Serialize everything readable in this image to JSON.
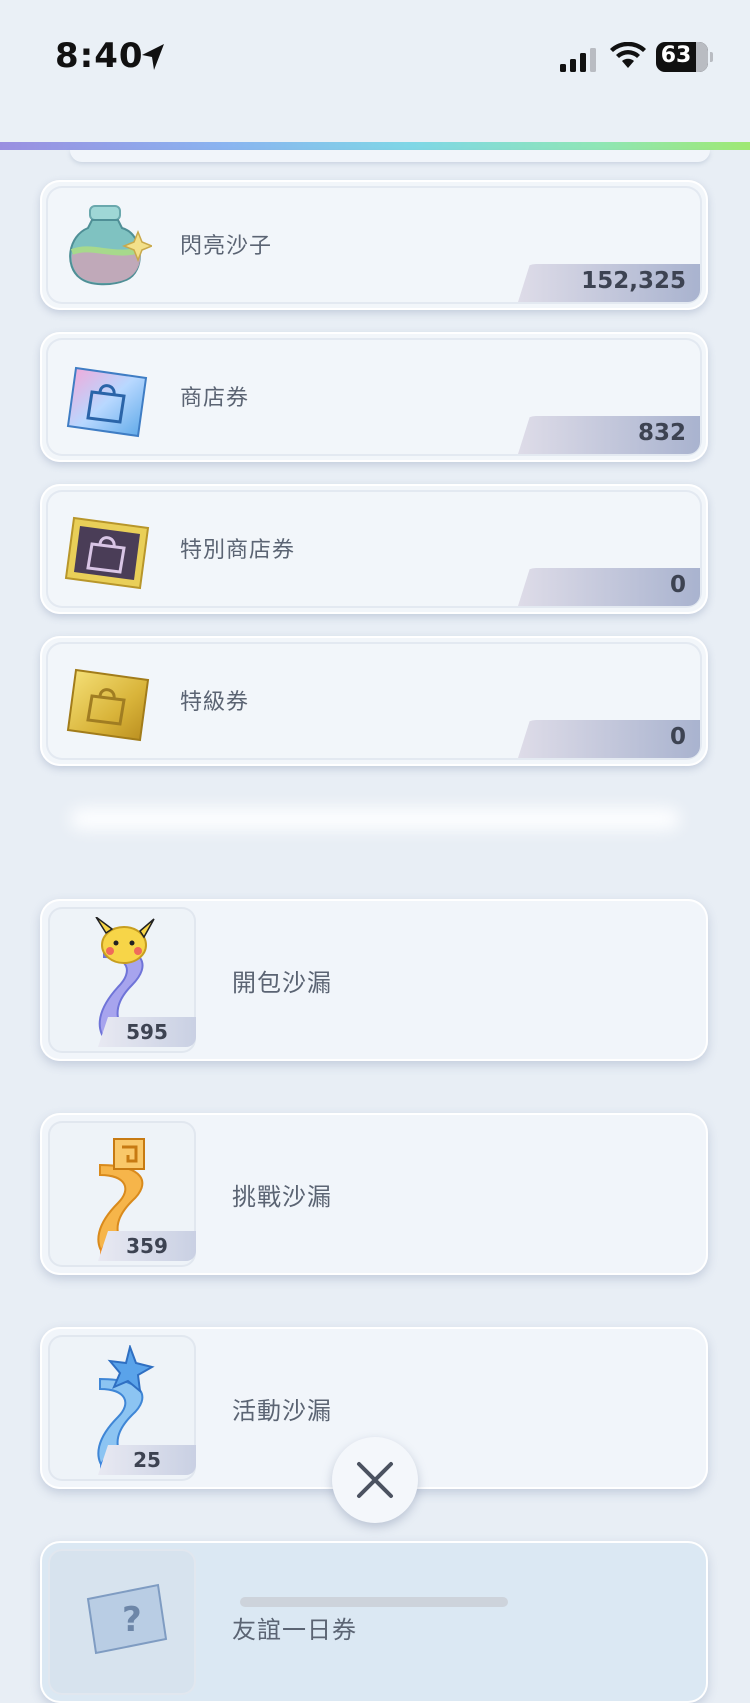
{
  "status_bar": {
    "time": "8:40",
    "battery": "63"
  },
  "currencies": [
    {
      "name": "閃亮沙子",
      "amount": "152,325",
      "icon": "sand-bottle-icon"
    },
    {
      "name": "商店券",
      "amount": "832",
      "icon": "shop-ticket-icon"
    },
    {
      "name": "特別商店券",
      "amount": "0",
      "icon": "special-shop-ticket-icon"
    },
    {
      "name": "特級券",
      "amount": "0",
      "icon": "premium-ticket-icon"
    }
  ],
  "hourglasses": [
    {
      "name": "開包沙漏",
      "count": "595",
      "icon": "pack-hourglass-icon"
    },
    {
      "name": "挑戰沙漏",
      "count": "359",
      "icon": "challenge-hourglass-icon"
    },
    {
      "name": "活動沙漏",
      "count": "25",
      "icon": "event-hourglass-icon"
    }
  ],
  "partial_item": {
    "name": "友誼一日券"
  },
  "close_button": {
    "icon": "close-icon"
  }
}
